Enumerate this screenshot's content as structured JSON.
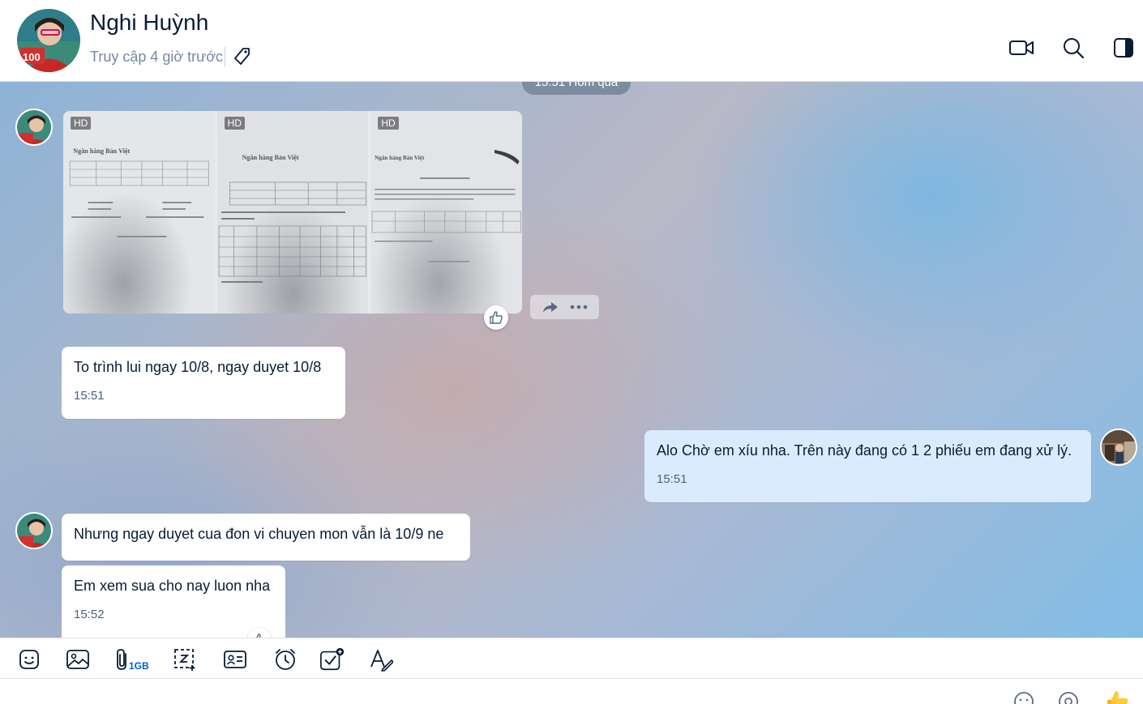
{
  "header": {
    "name": "Nghi Huỳnh",
    "status": "Truy cập 4 giờ trước",
    "avatar_badge": "100"
  },
  "chat": {
    "time_divider": "15:51 Hôm qua",
    "photos": [
      {
        "badge": "HD",
        "bank": "Ngân hàng Bản Việt"
      },
      {
        "badge": "HD",
        "bank": "Ngân hàng Bản Việt"
      },
      {
        "badge": "HD",
        "bank": "Ngân hàng Bản Việt"
      }
    ],
    "messages": [
      {
        "text": "To trình lui ngay 10/8, ngay duyet 10/8",
        "time": "15:51"
      },
      {
        "text": "Alo Chờ em xíu nha. Trên này đang có 1 2 phiếu em đang xử lý.",
        "time": "15:51"
      },
      {
        "text": "Nhưng ngay duyet cua đon vi chuyen mon vẫn là 10/9 ne",
        "time": ""
      },
      {
        "text": "Em xem sua cho nay luon nha",
        "time": "15:52"
      }
    ]
  },
  "toolbar": {
    "file_limit": "1GB"
  },
  "input": {
    "placeholder": ""
  },
  "colors": {
    "accent": "#005ae0",
    "my_bubble": "#dbebff",
    "their_bubble": "#ffffff"
  },
  "icons": [
    "video-call-icon",
    "search-icon",
    "sidebar-toggle-icon",
    "tag-icon",
    "sticker-icon",
    "image-icon",
    "attach-icon",
    "screenshot-icon",
    "contact-card-icon",
    "reminder-icon",
    "task-icon",
    "format-text-icon",
    "emoji-icon",
    "mention-icon",
    "thumbs-up-icon",
    "share-icon",
    "more-icon"
  ]
}
